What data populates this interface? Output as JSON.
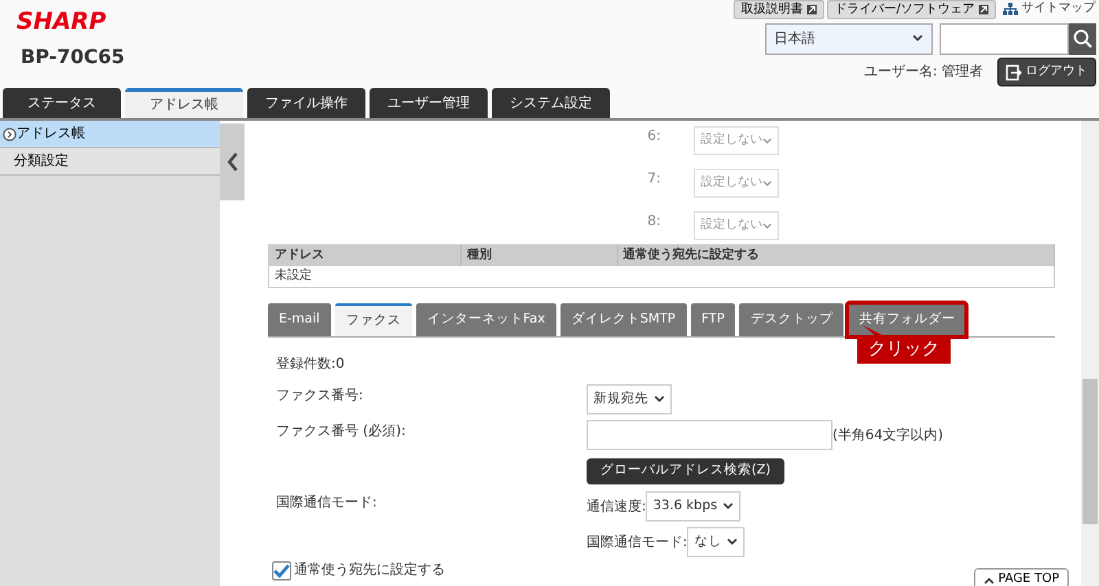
{
  "header": {
    "logo": "SHARP",
    "model": "BP-70C65",
    "links": [
      {
        "label": "取扱説明書"
      },
      {
        "label": "ドライバー/ソフトウェア"
      }
    ],
    "sitemap": "サイトマップ",
    "language": {
      "value": "日本語"
    },
    "user": "ユーザー名: 管理者",
    "logout": "ログアウト"
  },
  "tabs": [
    {
      "label": "ステータス",
      "selected": false
    },
    {
      "label": "アドレス帳",
      "selected": true
    },
    {
      "label": "ファイル操作",
      "selected": false
    },
    {
      "label": "ユーザー管理",
      "selected": false
    },
    {
      "label": "システム設定",
      "selected": false
    }
  ],
  "sidebar": {
    "items": [
      {
        "label": "アドレス帳",
        "selected": true
      },
      {
        "label": "分類設定",
        "selected": false
      }
    ]
  },
  "priority_rows": [
    {
      "label": "6:",
      "value": "設定しない",
      "disabled": true
    },
    {
      "label": "7:",
      "value": "設定しない",
      "disabled": true
    },
    {
      "label": "8:",
      "value": "設定しない",
      "disabled": true
    }
  ],
  "address_table": {
    "columns": [
      "アドレス",
      "種別",
      "通常使う宛先に設定する"
    ],
    "rows": [
      [
        "未設定"
      ]
    ]
  },
  "sub_tabs": [
    {
      "label": "E-mail",
      "selected": false,
      "highlighted": false
    },
    {
      "label": "ファクス",
      "selected": true,
      "highlighted": false
    },
    {
      "label": "インターネットFax",
      "selected": false,
      "highlighted": false
    },
    {
      "label": "ダイレクトSMTP",
      "selected": false,
      "highlighted": false
    },
    {
      "label": "FTP",
      "selected": false,
      "highlighted": false
    },
    {
      "label": "デスクトップ",
      "selected": false,
      "highlighted": false
    },
    {
      "label": "共有フォルダー",
      "selected": false,
      "highlighted": true
    }
  ],
  "callout": "クリック",
  "count": "登録件数:0",
  "form": [
    {
      "kind": "select",
      "label": "ファクス番号:",
      "value": "新規宛先"
    },
    {
      "kind": "input",
      "label": "ファクス番号 (必須):",
      "note": "(半角64文字以内)"
    },
    {
      "kind": "button",
      "text": "グローバルアドレス検索(Z)"
    },
    {
      "kind": "select",
      "label": "国際通信モード:",
      "prefix": "通信速度:",
      "value": "33.6 kbps"
    },
    {
      "kind": "select",
      "prefix": "国際通信モード:",
      "value": "なし"
    }
  ],
  "checkbox": {
    "label": "通常使う宛先に設定する",
    "checked": true
  },
  "page_top": "PAGE TOP"
}
